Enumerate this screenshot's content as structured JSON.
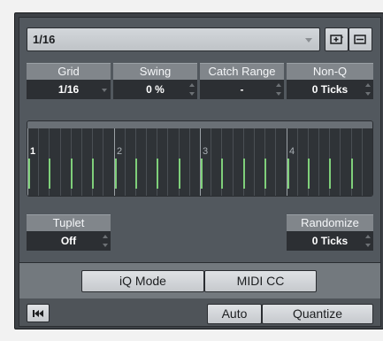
{
  "preset": {
    "value": "1/16"
  },
  "toolbar_icons": [
    "add-preset-icon",
    "preset-list-icon"
  ],
  "params": {
    "grid": {
      "label": "Grid",
      "value": "1/16"
    },
    "swing": {
      "label": "Swing",
      "value": "0 %"
    },
    "catch_range": {
      "label": "Catch Range",
      "value": "-"
    },
    "non_q": {
      "label": "Non-Q",
      "value": "0 Ticks"
    },
    "tuplet": {
      "label": "Tuplet",
      "value": "Off"
    },
    "randomize": {
      "label": "Randomize",
      "value": "0 Ticks"
    }
  },
  "grid_display": {
    "beats": [
      "1",
      "2",
      "3",
      "4"
    ],
    "subdivisions_per_beat": 4
  },
  "mode_bar": {
    "iq_label": "iQ Mode",
    "midi_cc_label": "MIDI CC"
  },
  "footer": {
    "auto_label": "Auto",
    "quantize_label": "Quantize"
  },
  "colors": {
    "panel_bg": "#52585e",
    "label_bg": "#81868b",
    "value_bg": "#2c2f33",
    "grid_tick": "#7fcf7a"
  }
}
